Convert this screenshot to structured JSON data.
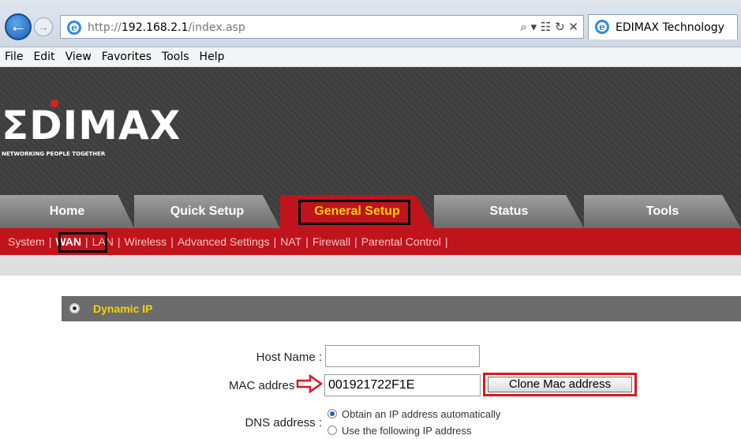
{
  "browser": {
    "url_prefix": "http://",
    "url_host": "192.168.2.1",
    "url_path": "/index.asp",
    "address_tools": "⌕ ▾ ☷ ↻ ✕",
    "tab_title": "EDIMAX Technology"
  },
  "menubar": {
    "items": [
      "File",
      "Edit",
      "View",
      "Favorites",
      "Tools",
      "Help"
    ]
  },
  "brand": {
    "logo": "ΣDIMAX",
    "tagline": "NETWORKING PEOPLE TOGETHER",
    "accent_color": "#c0141d",
    "highlight_color": "#f7d400"
  },
  "main_tabs": [
    "Home",
    "Quick Setup",
    "General Setup",
    "Status",
    "Tools"
  ],
  "active_tab": "General Setup",
  "subnav": [
    "System",
    "WAN",
    "LAN",
    "Wireless",
    "Advanced Settings",
    "NAT",
    "Firewall",
    "Parental Control"
  ],
  "active_subnav": "WAN",
  "section": {
    "title": "Dynamic IP"
  },
  "form": {
    "host_name_label": "Host Name :",
    "host_name_value": "",
    "mac_label": "MAC addres",
    "mac_value": "001921722F1E",
    "clone_button": "Clone Mac address",
    "dns_label": "DNS address :",
    "dns_option_auto": "Obtain an IP address automatically",
    "dns_option_manual": "Use the following IP address"
  }
}
